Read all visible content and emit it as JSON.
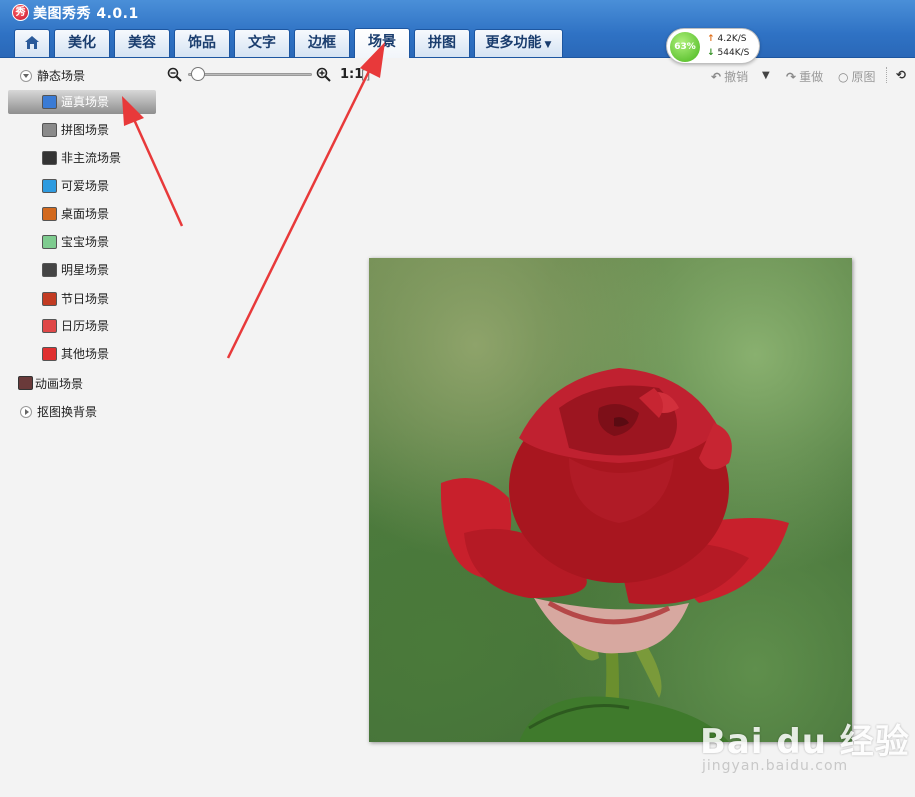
{
  "app": {
    "logo_glyph": "秀",
    "title": "美图秀秀 4.0.1"
  },
  "tabs": [
    {
      "label": "美化",
      "active": false
    },
    {
      "label": "美容",
      "active": false
    },
    {
      "label": "饰品",
      "active": false
    },
    {
      "label": "文字",
      "active": false
    },
    {
      "label": "边框",
      "active": false
    },
    {
      "label": "场景",
      "active": true
    },
    {
      "label": "拼图",
      "active": false
    },
    {
      "label": "更多功能",
      "active": false
    }
  ],
  "network": {
    "percent": "63%",
    "upload": "4.2K/S",
    "download": "544K/S"
  },
  "sidebar": {
    "group_static": "静态场景",
    "items": [
      {
        "label": "逼真场景",
        "icon": "realistic-scene-icon",
        "selected": true,
        "color": "#3a7bd5"
      },
      {
        "label": "拼图场景",
        "icon": "collage-scene-icon",
        "selected": false,
        "color": "#8a8a8a"
      },
      {
        "label": "非主流场景",
        "icon": "alternative-scene-icon",
        "selected": false,
        "color": "#333333"
      },
      {
        "label": "可爱场景",
        "icon": "cute-scene-icon",
        "selected": false,
        "color": "#2e9be0"
      },
      {
        "label": "桌面场景",
        "icon": "desktop-scene-icon",
        "selected": false,
        "color": "#d2691e"
      },
      {
        "label": "宝宝场景",
        "icon": "baby-scene-icon",
        "selected": false,
        "color": "#7ecb8f"
      },
      {
        "label": "明星场景",
        "icon": "star-scene-icon",
        "selected": false,
        "color": "#444444"
      },
      {
        "label": "节日场景",
        "icon": "festival-scene-icon",
        "selected": false,
        "color": "#c23b22"
      },
      {
        "label": "日历场景",
        "icon": "calendar-scene-icon",
        "selected": false,
        "color": "#e04848"
      },
      {
        "label": "其他场景",
        "icon": "other-scene-icon",
        "selected": false,
        "color": "#e03030"
      }
    ],
    "group_animated": "动画场景",
    "group_cutout": "抠图换背景"
  },
  "toolbar": {
    "zoom_ratio": "1:1",
    "zoom_fit": "[]",
    "zoom_level": 0.03,
    "undo": "撤销",
    "redo": "重做",
    "original": "原图"
  },
  "watermark": {
    "brand": "Bai du 经验",
    "site": "jingyan.baidu.com"
  },
  "colors": {
    "accent": "#2f72c4",
    "annotation": "#e8393a",
    "selected_item": "#8e8e8e"
  }
}
